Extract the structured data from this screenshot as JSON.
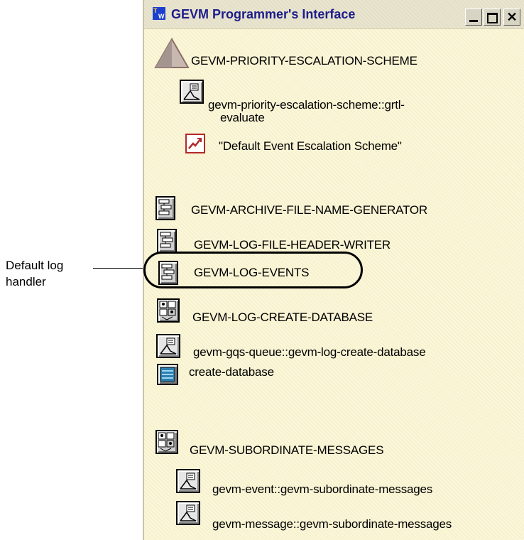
{
  "callout": {
    "line1": "Default log",
    "line2": "handler"
  },
  "window": {
    "title": "GEVM Programmer's Interface",
    "app_icon": {
      "t": "T",
      "w": "W"
    },
    "buttons": {
      "minimize": "minimize-icon",
      "maximize": "maximize-icon",
      "close": "✕"
    },
    "colors": {
      "background": "#fbf6d6",
      "titlebar": "#e9e4cd",
      "title_text": "#1c1c8c"
    }
  },
  "items": {
    "escalation_scheme": {
      "label": "GEVM-PRIORITY-ESCALATION-SCHEME",
      "icon": "triangle-icon"
    },
    "grtl_evaluate": {
      "label_line1": "gevm-priority-escalation-scheme::grtl-",
      "label_line2": "evaluate",
      "icon": "method-icon"
    },
    "default_scheme": {
      "label": "\"Default Event Escalation Scheme\"",
      "icon": "trend-icon"
    },
    "archive_generator": {
      "label": "GEVM-ARCHIVE-FILE-NAME-GENERATOR",
      "icon": "procedure-icon"
    },
    "header_writer": {
      "label": "GEVM-LOG-FILE-HEADER-WRITER",
      "icon": "procedure-icon"
    },
    "log_events": {
      "label": "GEVM-LOG-EVENTS",
      "icon": "procedure-icon"
    },
    "log_create_db": {
      "label": "GEVM-LOG-CREATE-DATABASE",
      "icon": "procedure-multi-icon"
    },
    "gqs_queue_method": {
      "label": "gevm-gqs-queue::gevm-log-create-database",
      "icon": "method-icon"
    },
    "create_database": {
      "label": "create-database",
      "icon": "database-icon"
    },
    "subordinate_messages": {
      "label": "GEVM-SUBORDINATE-MESSAGES",
      "icon": "procedure-multi-icon"
    },
    "event_method": {
      "label": "gevm-event::gevm-subordinate-messages",
      "icon": "method-icon"
    },
    "message_method": {
      "label": "gevm-message::gevm-subordinate-messages",
      "icon": "method-icon"
    }
  }
}
